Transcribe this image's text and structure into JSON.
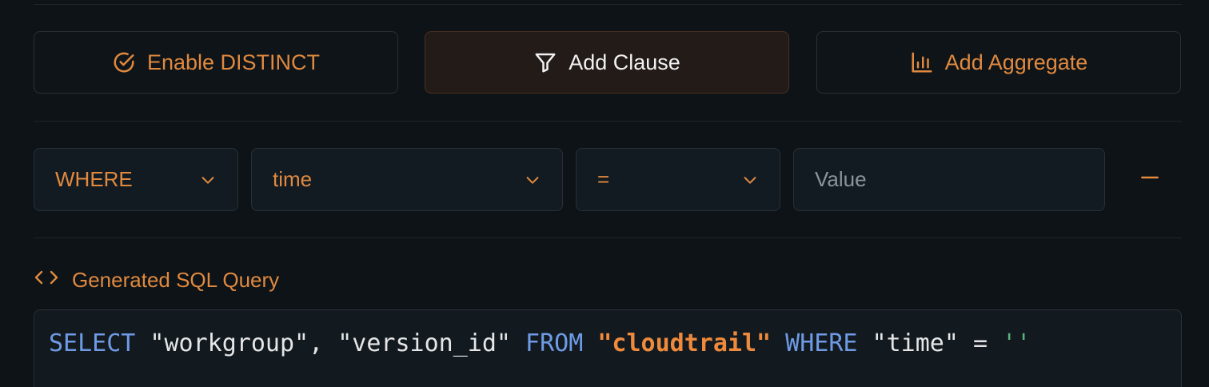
{
  "actions": {
    "distinct_label": "Enable DISTINCT",
    "clause_label": "Add Clause",
    "aggregate_label": "Add Aggregate"
  },
  "clause": {
    "type": "WHERE",
    "column": "time",
    "operator": "=",
    "value_placeholder": "Value"
  },
  "sql": {
    "heading": "Generated SQL Query",
    "tokens": {
      "select": "SELECT",
      "columns": " \"workgroup\", \"version_id\" ",
      "from": "FROM",
      "sp1": " ",
      "table": "\"cloudtrail\"",
      "sp2": " ",
      "where": "WHERE",
      "condition": " \"time\" = ",
      "literal": "''"
    }
  },
  "colors": {
    "accent": "#e0893f",
    "keyword": "#6f9be6",
    "string": "#5bb37a",
    "background": "#0d1317"
  },
  "icons": {
    "distinct": "check-circle-icon",
    "clause": "filter-icon",
    "aggregate": "bar-chart-icon",
    "dropdown": "chevron-down-icon",
    "remove": "minus-icon",
    "sql": "code-icon"
  }
}
